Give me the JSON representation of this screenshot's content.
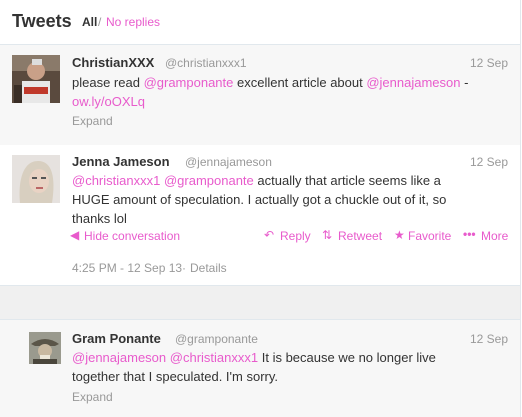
{
  "header": {
    "title": "Tweets",
    "filter_all": "All",
    "separator": "/",
    "filter_no_replies": "No replies"
  },
  "tweets": [
    {
      "name": "ChristianXXX",
      "handle": "@christianxxx1",
      "date": "12 Sep",
      "text_lines": [
        [
          "please read ",
          "@gramponante",
          " excellent article about ",
          "@jennajameson",
          " -"
        ],
        [
          "ow.ly/oOXLq"
        ]
      ],
      "expand": "Expand"
    },
    {
      "name": "Jenna Jameson",
      "handle": "@jennajameson",
      "date": "12 Sep",
      "text_line1_mention1": "@christianxxx1",
      "text_line1_mention2": "@gramponante",
      "text_line1_rest": " actually that article seems like a",
      "text_line2": "HUGE amount of speculation. I actually got a chuckle out of it, so",
      "text_line3": "thanks lol",
      "hide_conversation": "Hide conversation",
      "reply": "Reply",
      "retweet": "Retweet",
      "favorite": "Favorite",
      "more": "More",
      "timestamp": "4:25 PM - 12 Sep 13",
      "details_sep": "·",
      "details": "Details"
    },
    {
      "name": "Gram Ponante",
      "handle": "@gramponante",
      "date": "12 Sep",
      "text_line1_mention1": "@jennajameson",
      "text_line1_mention2": "@christianxxx1",
      "text_line1_rest": " It is because we no longer live",
      "text_line2": "together that I speculated. I'm sorry.",
      "expand": "Expand"
    }
  ],
  "icons": {
    "hide": "speech-bubble-icon",
    "reply": "reply-arrow-icon",
    "retweet": "retweet-icon",
    "favorite": "star-icon",
    "more": "ellipsis-icon"
  },
  "colors": {
    "accent": "#e85bcc",
    "muted": "#999999",
    "text": "#333333"
  }
}
